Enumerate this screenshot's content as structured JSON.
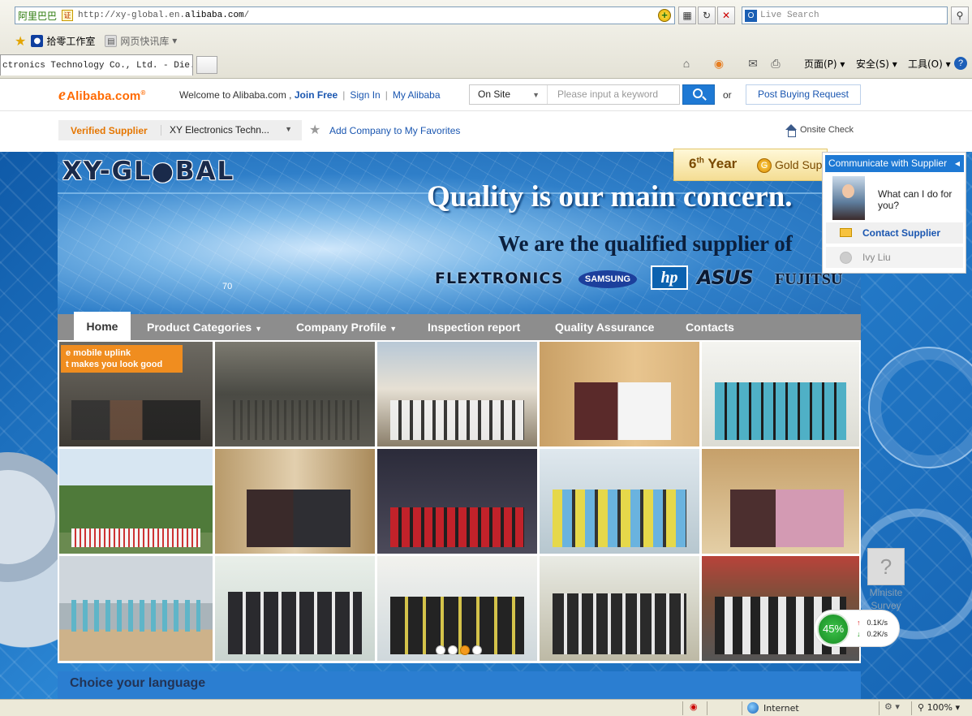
{
  "browser": {
    "site_name": "阿里巴巴",
    "site_badge": "证",
    "url_prefix": "http://xy-global.en.",
    "url_domain": "alibaba.com",
    "url_suffix": "/",
    "live_search_placeholder": "Live Search",
    "favorites": [
      {
        "label": "拾零工作室"
      },
      {
        "label": "网页快讯库"
      }
    ],
    "tab_title": "ctronics Technology Co., Ltd. - Die...",
    "commands": {
      "page": "页面(P)",
      "safety": "安全(S)",
      "tools": "工具(O)"
    },
    "status_zone": "Internet",
    "zoom": "100%"
  },
  "alibaba": {
    "logo": "Alibaba.com",
    "welcome": "Welcome to Alibaba.com ,",
    "join": "Join Free",
    "sign_in": "Sign In",
    "my_alibaba": "My Alibaba",
    "search_scope": "On Site",
    "search_placeholder": "Please input a keyword",
    "or": "or",
    "post_request": "Post Buying Request"
  },
  "supplier": {
    "verified": "Verified Supplier",
    "company": "XY Electronics Techn...",
    "add_favorites": "Add Company to My Favorites",
    "onsite_check": "Onsite Check",
    "year": "6",
    "year_suffix": "th",
    "year_word": "Year",
    "gold_text": "Gold Sup"
  },
  "banner": {
    "logo": "XY-GL●BAL",
    "headline": "Quality is our main concern.",
    "subline": "We are the qualified supplier of",
    "tick": "70",
    "brands": [
      "FLEXTRONICS",
      "SAMSUNG",
      "hp",
      "ASUS",
      "FUJITSU"
    ]
  },
  "communicate": {
    "header": "Communicate with Supplier",
    "question": "What can I do for you?",
    "contact": "Contact Supplier",
    "person": "Ivy Liu"
  },
  "nav": {
    "home": "Home",
    "products": "Product Categories",
    "profile": "Company Profile",
    "inspection": "Inspection report",
    "quality": "Quality Assurance",
    "contacts": "Contacts"
  },
  "photo_banner": {
    "line1": "e mobile uplink",
    "line2": "t makes you look good"
  },
  "language": {
    "title": "Choice your language"
  },
  "survey": {
    "line1": "Minisite",
    "line2": "Survey"
  },
  "speed": {
    "percent": "45%",
    "up": "0.1K/s",
    "down": "0.2K/s"
  }
}
